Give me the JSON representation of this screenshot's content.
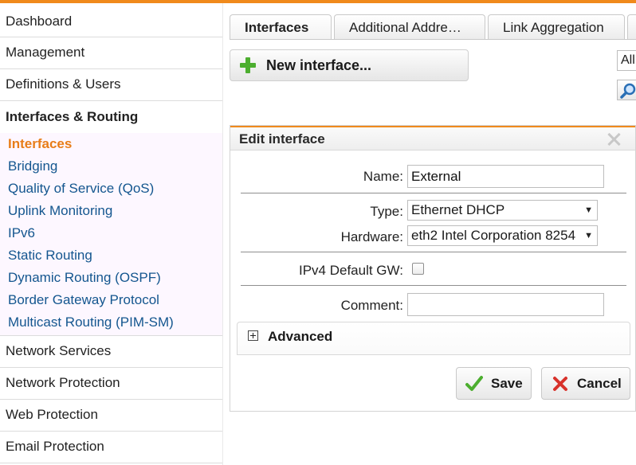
{
  "sidebar": {
    "items_top": [
      "Dashboard",
      "Management",
      "Definitions & Users"
    ],
    "section": {
      "label": "Interfaces & Routing",
      "sub_items": [
        "Interfaces",
        "Bridging",
        "Quality of Service (QoS)",
        "Uplink Monitoring",
        "IPv6",
        "Static Routing",
        "Dynamic Routing (OSPF)",
        "Border Gateway Protocol",
        "Multicast Routing (PIM-SM)"
      ],
      "active": "Interfaces"
    },
    "items_bottom": [
      "Network Services",
      "Network Protection",
      "Web Protection",
      "Email Protection"
    ]
  },
  "tabs": [
    {
      "label": "Interfaces",
      "active": true
    },
    {
      "label": "Additional Addre…",
      "active": false
    },
    {
      "label": "Link Aggregation",
      "active": false
    }
  ],
  "toolbar": {
    "new_interface_label": "New interface...",
    "filter_value": "All"
  },
  "edit_panel": {
    "title": "Edit interface",
    "name_label": "Name:",
    "name_value": "External",
    "type_label": "Type:",
    "type_value": "Ethernet DHCP",
    "hardware_label": "Hardware:",
    "hardware_value": "eth2 Intel Corporation 8254",
    "gw_label": "IPv4 Default GW:",
    "gw_checked": false,
    "comment_label": "Comment:",
    "comment_value": "",
    "advanced_label": "Advanced",
    "save_label": "Save",
    "cancel_label": "Cancel"
  },
  "colors": {
    "accent": "#f08a1c",
    "link": "#14568f",
    "active_item": "#e87d18",
    "save_icon": "#4cae2f",
    "cancel_icon": "#d8322b"
  },
  "icons": [
    "plus-icon",
    "search-icon",
    "close-icon",
    "expand-icon",
    "check-icon",
    "x-icon",
    "chevron-down-icon"
  ]
}
